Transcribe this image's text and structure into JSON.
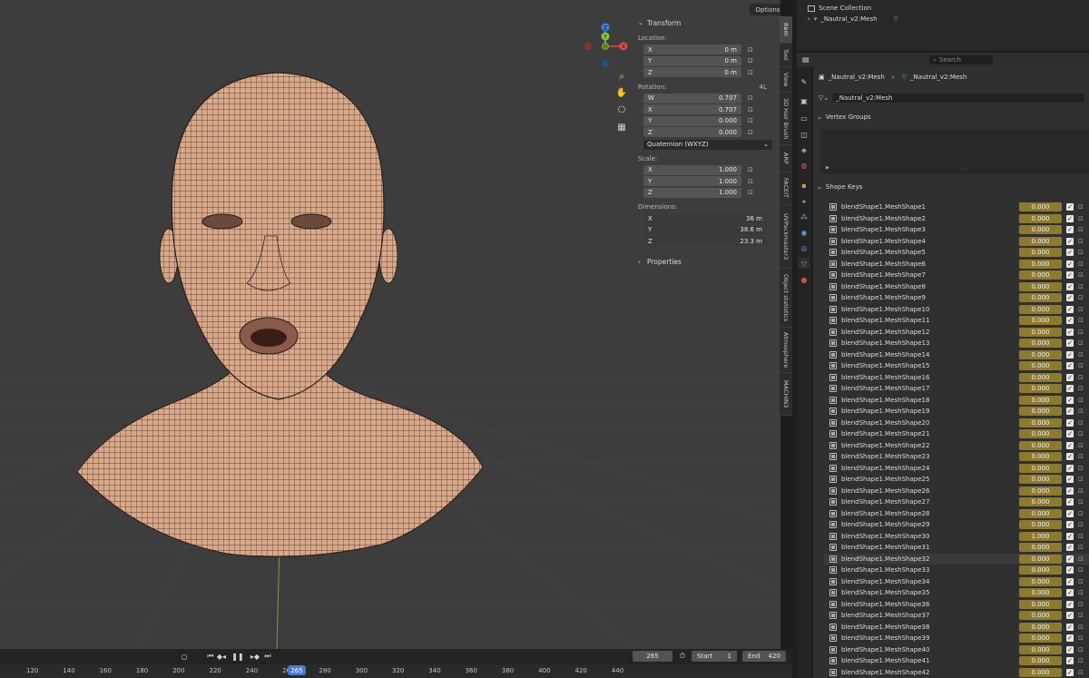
{
  "viewport": {
    "options_label": "Options",
    "gizmo": {
      "z": "Z",
      "y": "Y",
      "x": "X",
      "colors": {
        "x": "#e04848",
        "y": "#8ac43c",
        "z": "#3f7fe0"
      }
    },
    "nav_icons": [
      "zoom-icon",
      "hand-pan-icon",
      "camera-icon",
      "grid-view-icon"
    ],
    "mesh_color": "#d9a889",
    "background": "#3d3d3d"
  },
  "npanel": {
    "transform_label": "Transform",
    "location_label": "Location:",
    "location": [
      {
        "axis": "X",
        "value": "0 m"
      },
      {
        "axis": "Y",
        "value": "0 m"
      },
      {
        "axis": "Z",
        "value": "0 m"
      }
    ],
    "rotation_label": "Rotation:",
    "rotation_mode_tag": "4L",
    "rotation": [
      {
        "axis": "W",
        "value": "0.707"
      },
      {
        "axis": "X",
        "value": "0.707"
      },
      {
        "axis": "Y",
        "value": "0.000"
      },
      {
        "axis": "Z",
        "value": "0.000"
      }
    ],
    "rotation_mode": "Quaternion (WXYZ)",
    "scale_label": "Scale:",
    "scale": [
      {
        "axis": "X",
        "value": "1.000"
      },
      {
        "axis": "Y",
        "value": "1.000"
      },
      {
        "axis": "Z",
        "value": "1.000"
      }
    ],
    "dimensions_label": "Dimensions:",
    "dimensions": [
      {
        "axis": "X",
        "value": "36 m"
      },
      {
        "axis": "Y",
        "value": "38.6 m"
      },
      {
        "axis": "Z",
        "value": "23.3 m"
      }
    ],
    "properties_label": "Properties"
  },
  "side_tabs": [
    "Item",
    "Tool",
    "View",
    "3D Hair Brush",
    "ARP",
    "FACEIT",
    "UVPackmaster3",
    "Object statistics",
    "Atmosphere",
    "MACHIN3"
  ],
  "outliner": {
    "collection": "Scene Collection",
    "object": "_Nautral_v2:Mesh"
  },
  "properties": {
    "search_placeholder": "Search",
    "breadcrumb_object": "_Nautral_v2:Mesh",
    "breadcrumb_data": "_Nautral_v2:Mesh",
    "data_name": "_Nautral_v2:Mesh",
    "vertex_groups_label": "Vertex Groups",
    "shape_keys_label": "Shape Keys",
    "shape_keys": [
      {
        "name": "blendShape1.MeshShape1",
        "value": "0.000"
      },
      {
        "name": "blendShape1.MeshShape2",
        "value": "0.000"
      },
      {
        "name": "blendShape1.MeshShape3",
        "value": "0.000"
      },
      {
        "name": "blendShape1.MeshShape4",
        "value": "0.000"
      },
      {
        "name": "blendShape1.MeshShape5",
        "value": "0.000"
      },
      {
        "name": "blendShape1.MeshShape6",
        "value": "0.000"
      },
      {
        "name": "blendShape1.MeshShape7",
        "value": "0.000"
      },
      {
        "name": "blendShape1.MeshShape8",
        "value": "0.000"
      },
      {
        "name": "blendShape1.MeshShape9",
        "value": "0.000"
      },
      {
        "name": "blendShape1.MeshShape10",
        "value": "0.000"
      },
      {
        "name": "blendShape1.MeshShape11",
        "value": "0.000"
      },
      {
        "name": "blendShape1.MeshShape12",
        "value": "0.000"
      },
      {
        "name": "blendShape1.MeshShape13",
        "value": "0.000"
      },
      {
        "name": "blendShape1.MeshShape14",
        "value": "0.000"
      },
      {
        "name": "blendShape1.MeshShape15",
        "value": "0.000"
      },
      {
        "name": "blendShape1.MeshShape16",
        "value": "0.000"
      },
      {
        "name": "blendShape1.MeshShape17",
        "value": "0.000"
      },
      {
        "name": "blendShape1.MeshShape18",
        "value": "0.000"
      },
      {
        "name": "blendShape1.MeshShape19",
        "value": "0.000"
      },
      {
        "name": "blendShape1.MeshShape20",
        "value": "0.000"
      },
      {
        "name": "blendShape1.MeshShape21",
        "value": "0.000"
      },
      {
        "name": "blendShape1.MeshShape22",
        "value": "0.000"
      },
      {
        "name": "blendShape1.MeshShape23",
        "value": "0.000"
      },
      {
        "name": "blendShape1.MeshShape24",
        "value": "0.000"
      },
      {
        "name": "blendShape1.MeshShape25",
        "value": "0.000"
      },
      {
        "name": "blendShape1.MeshShape26",
        "value": "0.000"
      },
      {
        "name": "blendShape1.MeshShape27",
        "value": "0.000"
      },
      {
        "name": "blendShape1.MeshShape28",
        "value": "0.000"
      },
      {
        "name": "blendShape1.MeshShape29",
        "value": "0.000"
      },
      {
        "name": "blendShape1.MeshShape30",
        "value": "1.000"
      },
      {
        "name": "blendShape1.MeshShape31",
        "value": "0.000"
      },
      {
        "name": "blendShape1.MeshShape32",
        "value": "0.000"
      },
      {
        "name": "blendShape1.MeshShape33",
        "value": "0.000"
      },
      {
        "name": "blendShape1.MeshShape34",
        "value": "0.000"
      },
      {
        "name": "blendShape1.MeshShape35",
        "value": "0.000"
      },
      {
        "name": "blendShape1.MeshShape36",
        "value": "0.000"
      },
      {
        "name": "blendShape1.MeshShape37",
        "value": "0.000"
      },
      {
        "name": "blendShape1.MeshShape38",
        "value": "0.000"
      },
      {
        "name": "blendShape1.MeshShape39",
        "value": "0.000"
      },
      {
        "name": "blendShape1.MeshShape40",
        "value": "0.000"
      },
      {
        "name": "blendShape1.MeshShape41",
        "value": "0.000"
      },
      {
        "name": "blendShape1.MeshShape42",
        "value": "0.000"
      }
    ],
    "value_color": "#8e7a2f"
  },
  "timeline": {
    "current_frame": "265",
    "start_label": "Start",
    "start": "1",
    "end_label": "End",
    "end": "420",
    "ruler_ticks": [
      "120",
      "140",
      "160",
      "180",
      "200",
      "220",
      "240",
      "26",
      "280",
      "300",
      "320",
      "340",
      "360",
      "380",
      "400",
      "420",
      "440"
    ],
    "ruler_current": "265",
    "accent": "#4a7ad4"
  }
}
